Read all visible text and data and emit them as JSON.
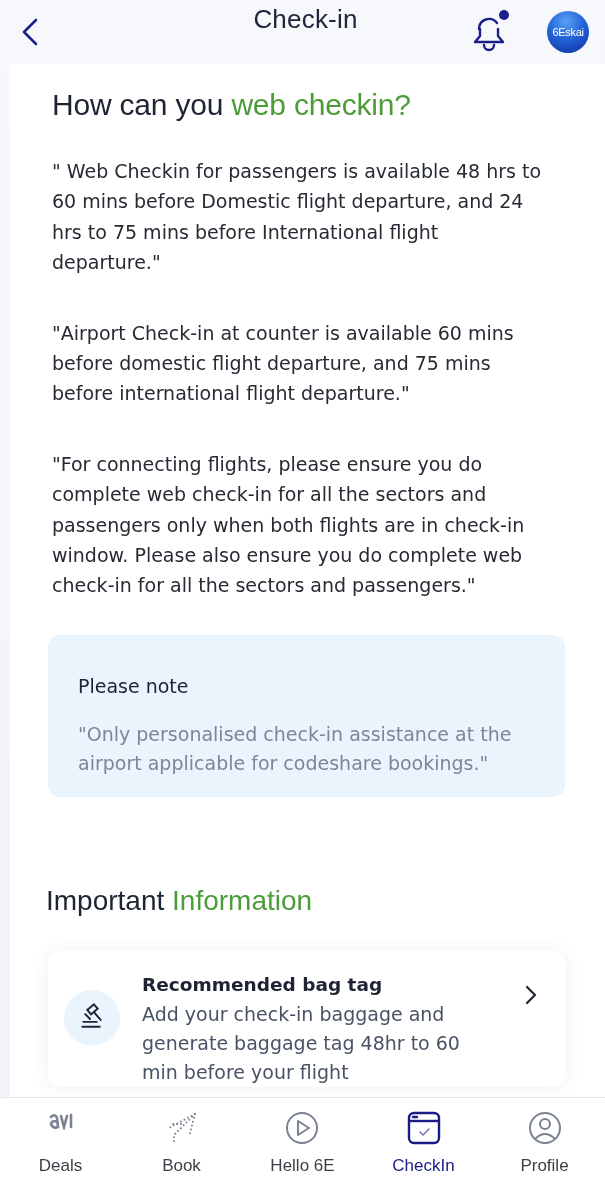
{
  "header": {
    "title": "Check-in",
    "notifications": {
      "unread": true
    },
    "avatar": {
      "label": "6Eskai"
    }
  },
  "intro": {
    "heading": {
      "text": "How can you",
      "highlight": "web checkin?"
    },
    "paragraphs": [
      "\" Web Checkin for passengers is available 48 hrs to 60 mins before Domestic flight departure, and 24 hrs to 75 mins before International flight departure.\"",
      "\"Airport Check-in at counter is available 60 mins before domestic flight departure, and 75 mins before international flight departure.\"",
      "\"For connecting flights, please ensure you do complete web check-in for all the sectors and passengers only when both flights are in check-in window. Please also ensure you do complete web check-in for all the sectors and passengers.\""
    ]
  },
  "note": {
    "title": "Please note",
    "text": "\"Only personalised check-in assistance at the airport applicable for codeshare bookings.\""
  },
  "important": {
    "heading": {
      "text": "Important",
      "highlight": "Information"
    },
    "cards": [
      {
        "title": "Recommended bag tag",
        "description": "Add your check-in baggage and generate baggage tag 48hr to 60 min before your flight"
      }
    ]
  },
  "bottom_nav": [
    {
      "kind": "deals",
      "label": "Deals",
      "selected": false
    },
    {
      "kind": "book",
      "label": "Book",
      "selected": false
    },
    {
      "kind": "hello",
      "label": "Hello 6E",
      "selected": false
    },
    {
      "kind": "checkin",
      "label": "CheckIn",
      "selected": true
    },
    {
      "kind": "profile",
      "label": "Profile",
      "selected": false
    }
  ]
}
